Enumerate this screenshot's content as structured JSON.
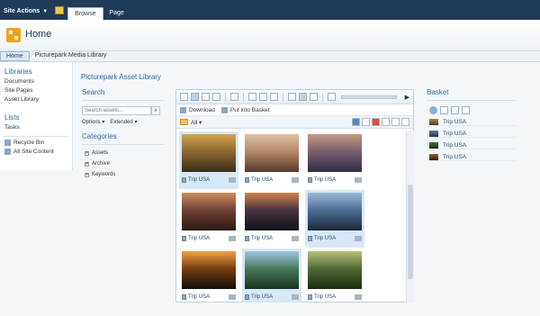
{
  "ribbon": {
    "site_actions": "Site Actions",
    "tabs": [
      "Browse",
      "Page"
    ]
  },
  "site": {
    "title": "Home"
  },
  "topnav": [
    "Home",
    "Picturepark Media Library"
  ],
  "quicklaunch": {
    "libraries_header": "Libraries",
    "libraries": [
      "Documents",
      "Site Pages",
      "Asset Library"
    ],
    "lists_header": "Lists",
    "lists": [
      "Tasks"
    ],
    "recycle_bin": "Recycle Bin",
    "all_site_content": "All Site Content"
  },
  "page_title": "Picturepark Asset Library",
  "search": {
    "header": "Search",
    "placeholder": "Search assets...",
    "options": "Options",
    "extended": "Extended"
  },
  "categories": {
    "header": "Categories",
    "items": [
      "Assets",
      "Archive",
      "Keywords"
    ]
  },
  "library": {
    "download": "Download",
    "put_into_basket": "Put into Basket",
    "filter": "All"
  },
  "assets": [
    {
      "caption": "Trip USA",
      "thumb_colors": [
        "#3a2b18",
        "#8d6a33",
        "#d3a34d"
      ],
      "selected": true
    },
    {
      "caption": "Trip USA",
      "thumb_colors": [
        "#5a3a2c",
        "#b58a6a",
        "#dfc0a4"
      ],
      "selected": false
    },
    {
      "caption": "Trip USA",
      "thumb_colors": [
        "#2e2f44",
        "#7a5f70",
        "#c49a7c"
      ],
      "selected": false
    },
    {
      "caption": "Trip USA",
      "thumb_colors": [
        "#2b1b14",
        "#734136",
        "#cf8d5e"
      ],
      "selected": false
    },
    {
      "caption": "Trip USA",
      "thumb_colors": [
        "#10111a",
        "#4a3540",
        "#d1814a"
      ],
      "selected": false
    },
    {
      "caption": "Trip USA",
      "thumb_colors": [
        "#1d2737",
        "#4f6f97",
        "#9bbad8"
      ],
      "selected": true
    },
    {
      "caption": "Trip USA",
      "thumb_colors": [
        "#120c08",
        "#7a3f13",
        "#f0a341"
      ],
      "selected": false
    },
    {
      "caption": "Trip USA",
      "thumb_colors": [
        "#16331e",
        "#4a7a5e",
        "#9fc6df"
      ],
      "selected": true
    },
    {
      "caption": "Trip USA",
      "thumb_colors": [
        "#1c2a12",
        "#536b36",
        "#b8c27a"
      ],
      "selected": false
    }
  ],
  "basket": {
    "header": "Basket",
    "items": [
      {
        "caption": "Trip USA",
        "thumb_colors": [
          "#4a3a1f",
          "#a78a4a"
        ]
      },
      {
        "caption": "Trip USA",
        "thumb_colors": [
          "#243446",
          "#5c7f9f"
        ]
      },
      {
        "caption": "Trip USA",
        "thumb_colors": [
          "#1d2a18",
          "#506b3c"
        ]
      },
      {
        "caption": "Trip USA",
        "thumb_colors": [
          "#2a1d14",
          "#a05e34"
        ]
      }
    ]
  }
}
